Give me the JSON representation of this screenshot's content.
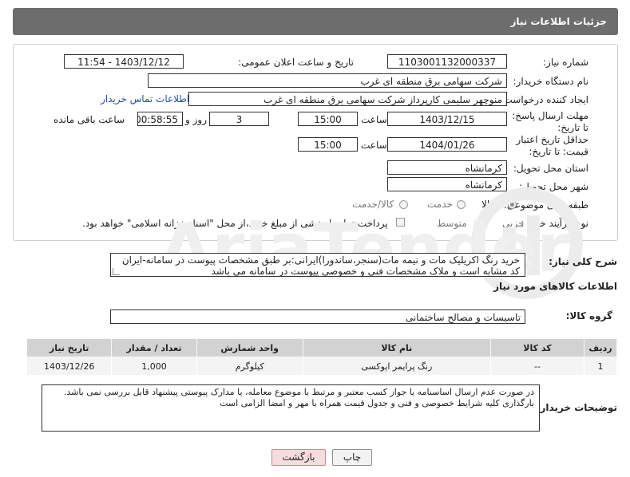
{
  "header": {
    "title": "جزئیات اطلاعات نیاز"
  },
  "form": {
    "need_number": {
      "label": "شماره نیاز:",
      "value": "1103001132000337"
    },
    "announce_datetime": {
      "label": "تاریخ و ساعت اعلان عمومی:",
      "value": "1403/12/12 - 11:54"
    },
    "buyer_org": {
      "label": "نام دستگاه خریدار:",
      "value": "شرکت سهامی برق منطقه ای غرب"
    },
    "requester": {
      "label": "ایجاد کننده درخواست:",
      "value": "منوچهر  سلیمی کارپرداز شرکت سهامی برق منطقه ای غرب",
      "contact_link": "اطلاعات تماس خریدار"
    },
    "response_deadline": {
      "label": "مهلت ارسال پاسخ: تا تاریخ:",
      "date": "1403/12/15",
      "time_label": "ساعت",
      "time": "15:00",
      "days": "3",
      "days_label": "روز و",
      "remaining": "00:58:55",
      "remaining_label": "ساعت باقی مانده"
    },
    "price_validity": {
      "label": "حداقل تاریخ اعتبار قیمت: تا تاریخ:",
      "date": "1404/01/26",
      "time_label": "ساعت",
      "time": "15:00"
    },
    "delivery_province": {
      "label": "استان محل تحویل:",
      "value": "کرمانشاه"
    },
    "delivery_city": {
      "label": "شهر محل تحویل:",
      "value": "کرمانشاه"
    },
    "category": {
      "label": "طبقه بندی موضوعی:",
      "options": [
        "کالا",
        "خدمت",
        "کالا/خدمت"
      ],
      "selected": "کالا"
    },
    "purchase_process": {
      "label": "نوع فرآیند خرید :",
      "options": [
        "جزیی",
        "متوسط"
      ],
      "payment_note": "پرداخت تمام یا بخشی از مبلغ خرید،از محل \"اسناد خزانه اسلامی\" خواهد بود."
    }
  },
  "description": {
    "label": "شرح کلی نیاز:",
    "text": "خرید رنگ اکریلیک مات و نیمه مات(سنجر،ساندورا)ایرانی:بر طبق مشخصات پیوست در سامانه-ایران کد مشابه است و ملاک مشخصات فنی و خصوصی پیوست در سامانه می باشد"
  },
  "goods_info": {
    "title": "اطلاعات کالاهای مورد نیاز",
    "group_label": "گروه کالا:",
    "group_value": "تاسیسات و مصالح ساختمانی",
    "columns": [
      "ردیف",
      "کد کالا",
      "نام کالا",
      "واحد شمارش",
      "تعداد / مقدار",
      "تاریخ نیاز"
    ],
    "rows": [
      [
        "1",
        "--",
        "رنگ پرایمر اپوکسی",
        "کیلوگرم",
        "1,000",
        "1403/12/26"
      ]
    ]
  },
  "buyer_notes": {
    "label": "توضیحات خریدار:",
    "line1": "در صورت عدم ارسال اساسنامه یا جواز کسب معتبر و مرتبط با موضوع معامله،  یا مدارک پیوستی پیشنهاد قابل بررسی نمی باشد.",
    "line2": "بارگذاری کلیه شرایط خصوصی و فنی و جدول قیمت همراه با مهر و امضا الزامی است"
  },
  "actions": {
    "print": "چاپ",
    "back": "بازگشت"
  },
  "colors": {
    "header_bg": "#6d6d6d",
    "link": "#1f4fa8",
    "table_header": "#d2d2d2",
    "back_button": "#f7dcdc"
  },
  "icons": {
    "watermark": "aria-tender-logo-watermark"
  }
}
